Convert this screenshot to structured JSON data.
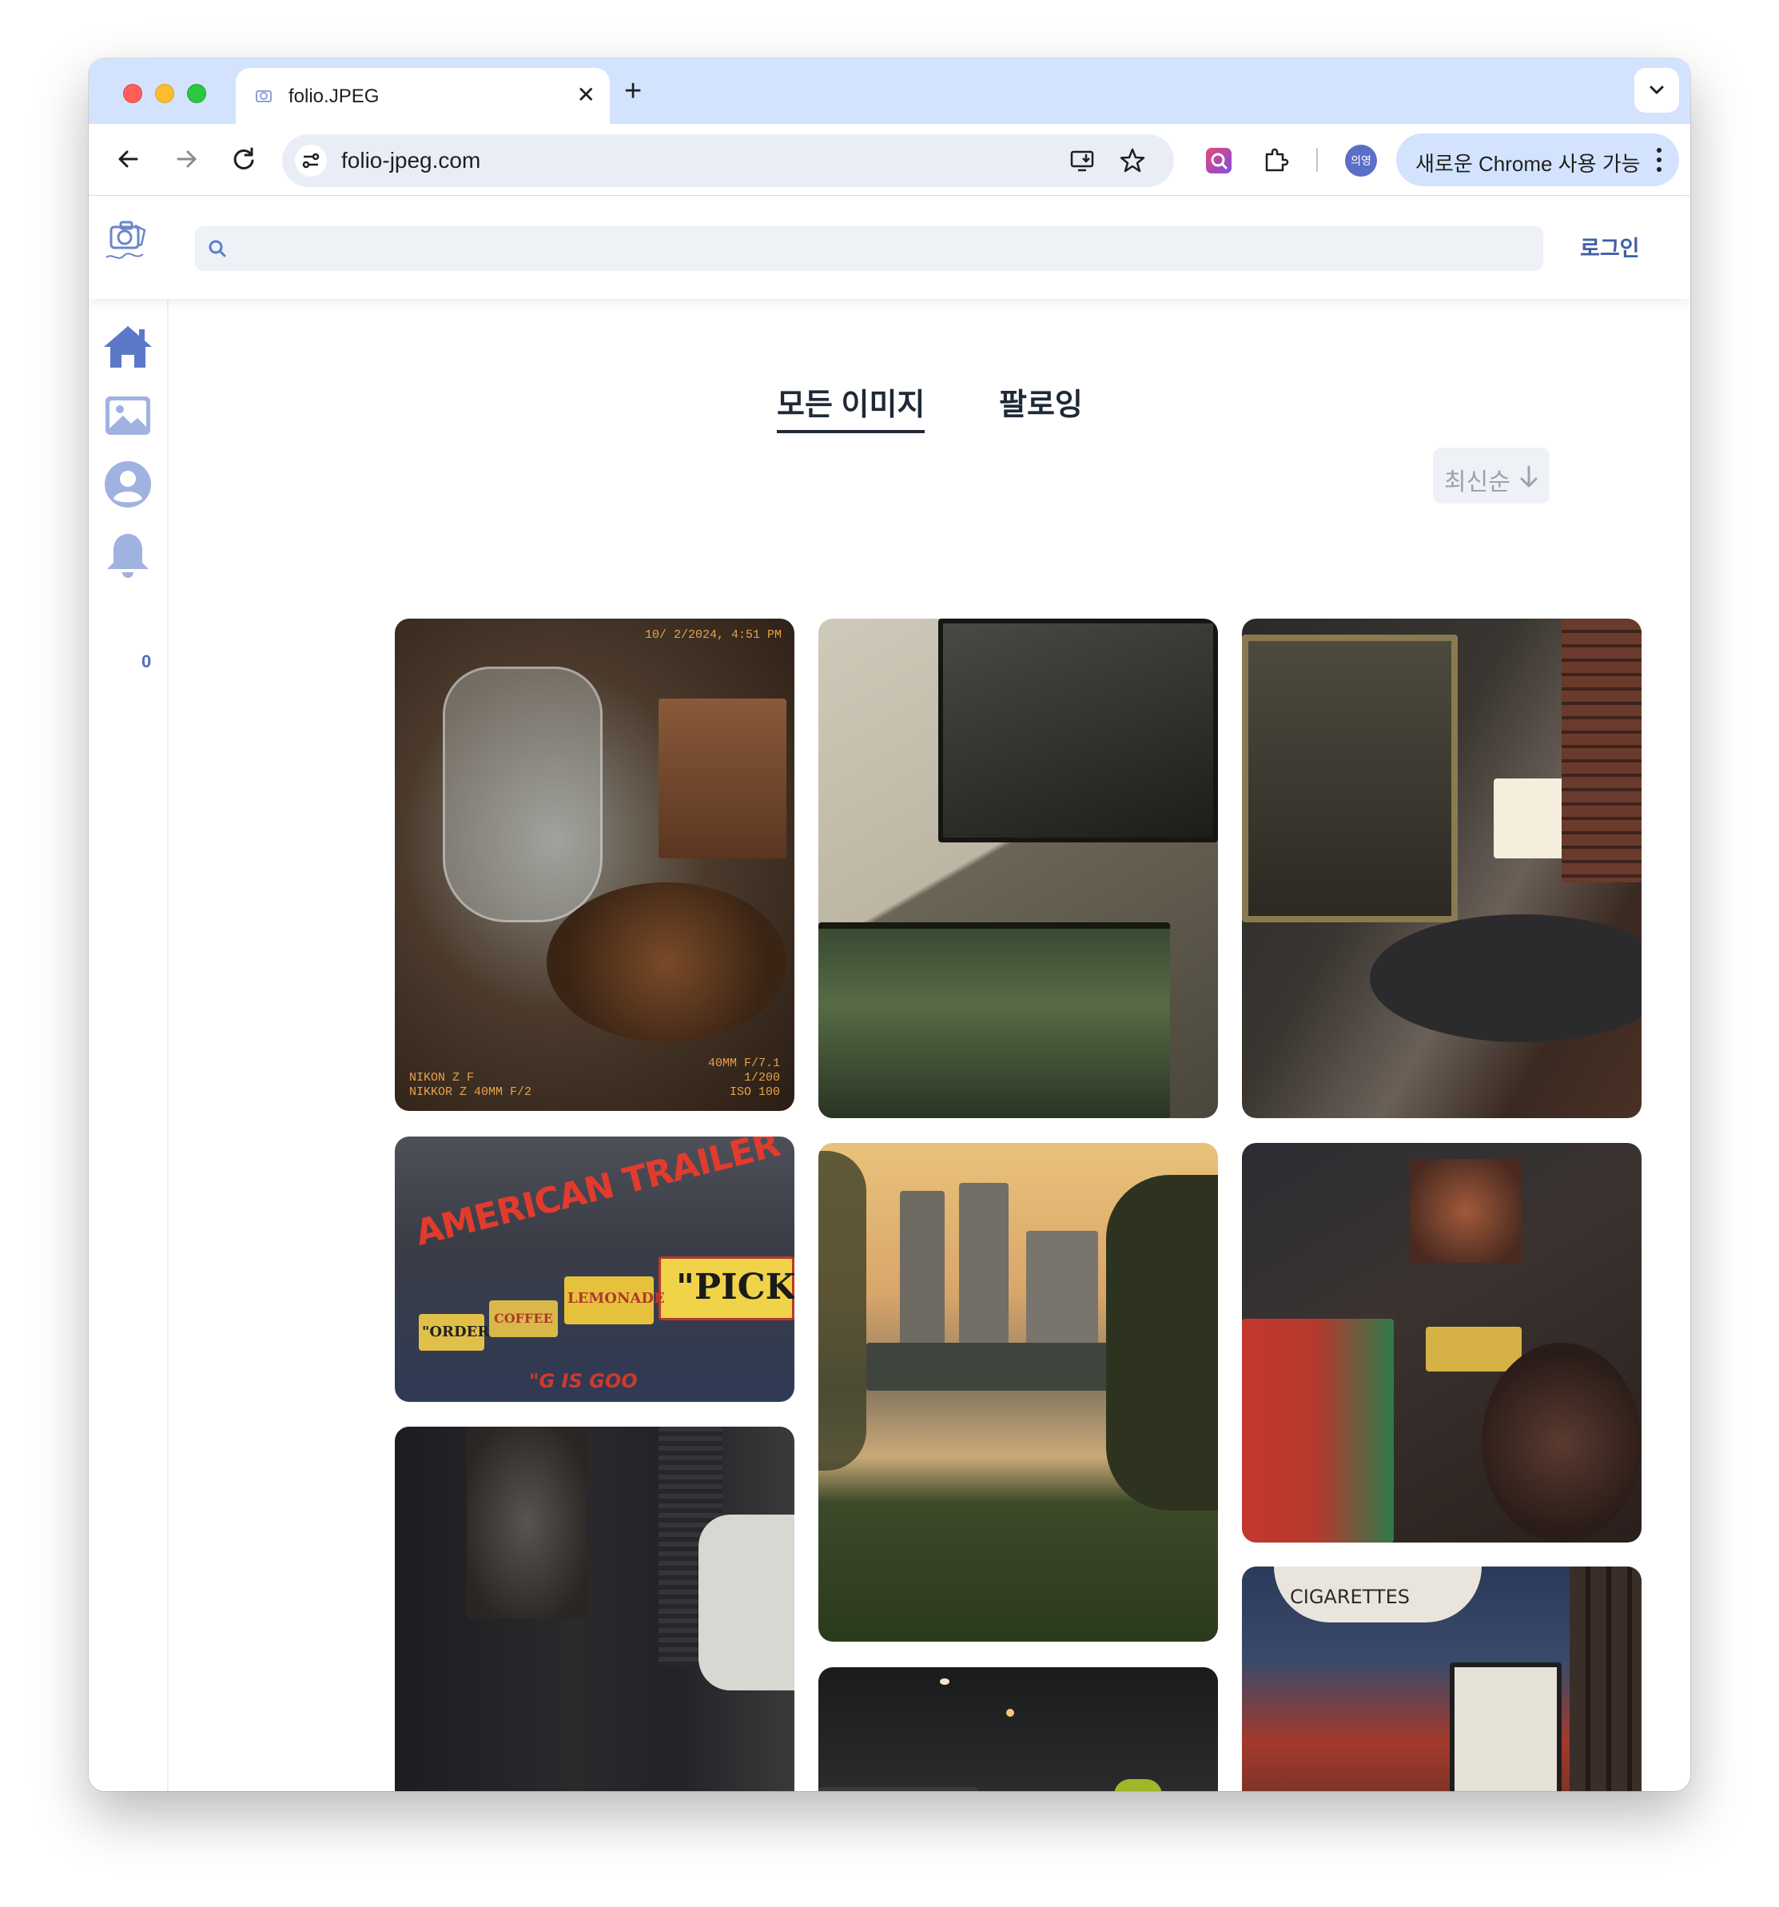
{
  "browser": {
    "tab_title": "folio.JPEG",
    "url": "folio-jpeg.com",
    "profile_label": "의영",
    "update_label": "새로운 Chrome 사용 가능"
  },
  "header": {
    "search_placeholder": "",
    "login_label": "로그인"
  },
  "sidenav": {
    "notification_count": "0"
  },
  "main": {
    "tabs": [
      "모든 이미지",
      "팔로잉"
    ],
    "sort_label": "최신순"
  },
  "photos": [
    {
      "id": "pitcher",
      "caption_top": "10/ 2/2024, 4:51 PM",
      "caption_bl": "NIKON Z F\nNIKKOR Z 40MM F/2",
      "caption_br": "40MM F/7.1\n1/200\nISO 100"
    },
    {
      "id": "wall-frames"
    },
    {
      "id": "lamp-painting"
    },
    {
      "id": "trailer-sign",
      "sign_text": "AMERICAN TRAILER",
      "sub_texts": [
        "\"PICK",
        "LEMONADE",
        "COFFEE",
        "\"ORDER",
        "\"G  IS GOO"
      ]
    },
    {
      "id": "han-river-sunset"
    },
    {
      "id": "dark-shop"
    },
    {
      "id": "alley"
    },
    {
      "id": "ceiling-lights"
    },
    {
      "id": "cigarettes-sign",
      "sign_text": "CIGARETTES"
    }
  ]
}
